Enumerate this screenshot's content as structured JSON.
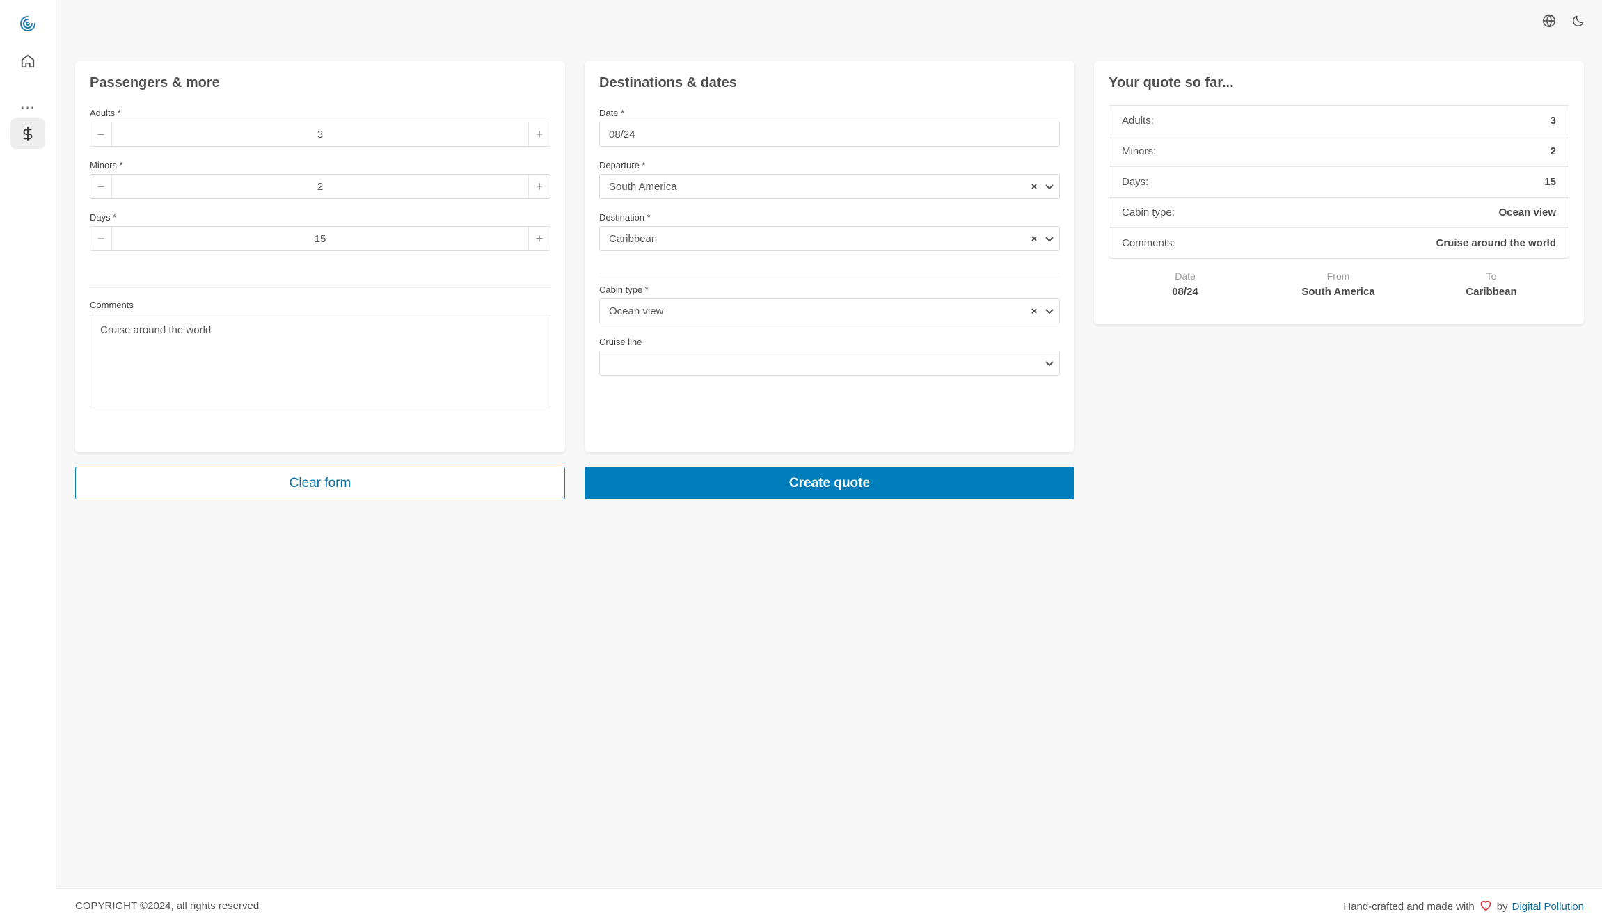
{
  "colors": {
    "accent": "#007dbb",
    "heart": "#e0353f"
  },
  "sidebar": {
    "more_label": "..."
  },
  "passengers": {
    "title": "Passengers & more",
    "adults": {
      "label": "Adults *",
      "value": "3"
    },
    "minors": {
      "label": "Minors *",
      "value": "2"
    },
    "days": {
      "label": "Days *",
      "value": "15"
    },
    "comments": {
      "label": "Comments",
      "value": "Cruise around the world"
    }
  },
  "destinations": {
    "title": "Destinations & dates",
    "date": {
      "label": "Date *",
      "value": "08/24"
    },
    "departure": {
      "label": "Departure *",
      "value": "South America"
    },
    "destination": {
      "label": "Destination *",
      "value": "Caribbean"
    },
    "cabin": {
      "label": "Cabin type *",
      "value": "Ocean view"
    },
    "cruise_line": {
      "label": "Cruise line",
      "value": ""
    }
  },
  "actions": {
    "clear_label": "Clear form",
    "create_label": "Create quote"
  },
  "quote": {
    "title": "Your quote so far...",
    "rows": [
      {
        "key": "Adults:",
        "value": "3"
      },
      {
        "key": "Minors:",
        "value": "2"
      },
      {
        "key": "Days:",
        "value": "15"
      },
      {
        "key": "Cabin type:",
        "value": "Ocean view"
      },
      {
        "key": "Comments:",
        "value": "Cruise around the world"
      }
    ],
    "summary": {
      "date_label": "Date",
      "date_value": "08/24",
      "from_label": "From",
      "from_value": "South America",
      "to_label": "To",
      "to_value": "Caribbean"
    }
  },
  "footer": {
    "copyright": "COPYRIGHT ©2024, all rights reserved",
    "crafted": "Hand-crafted and made with",
    "by": "by",
    "company": "Digital Pollution"
  }
}
